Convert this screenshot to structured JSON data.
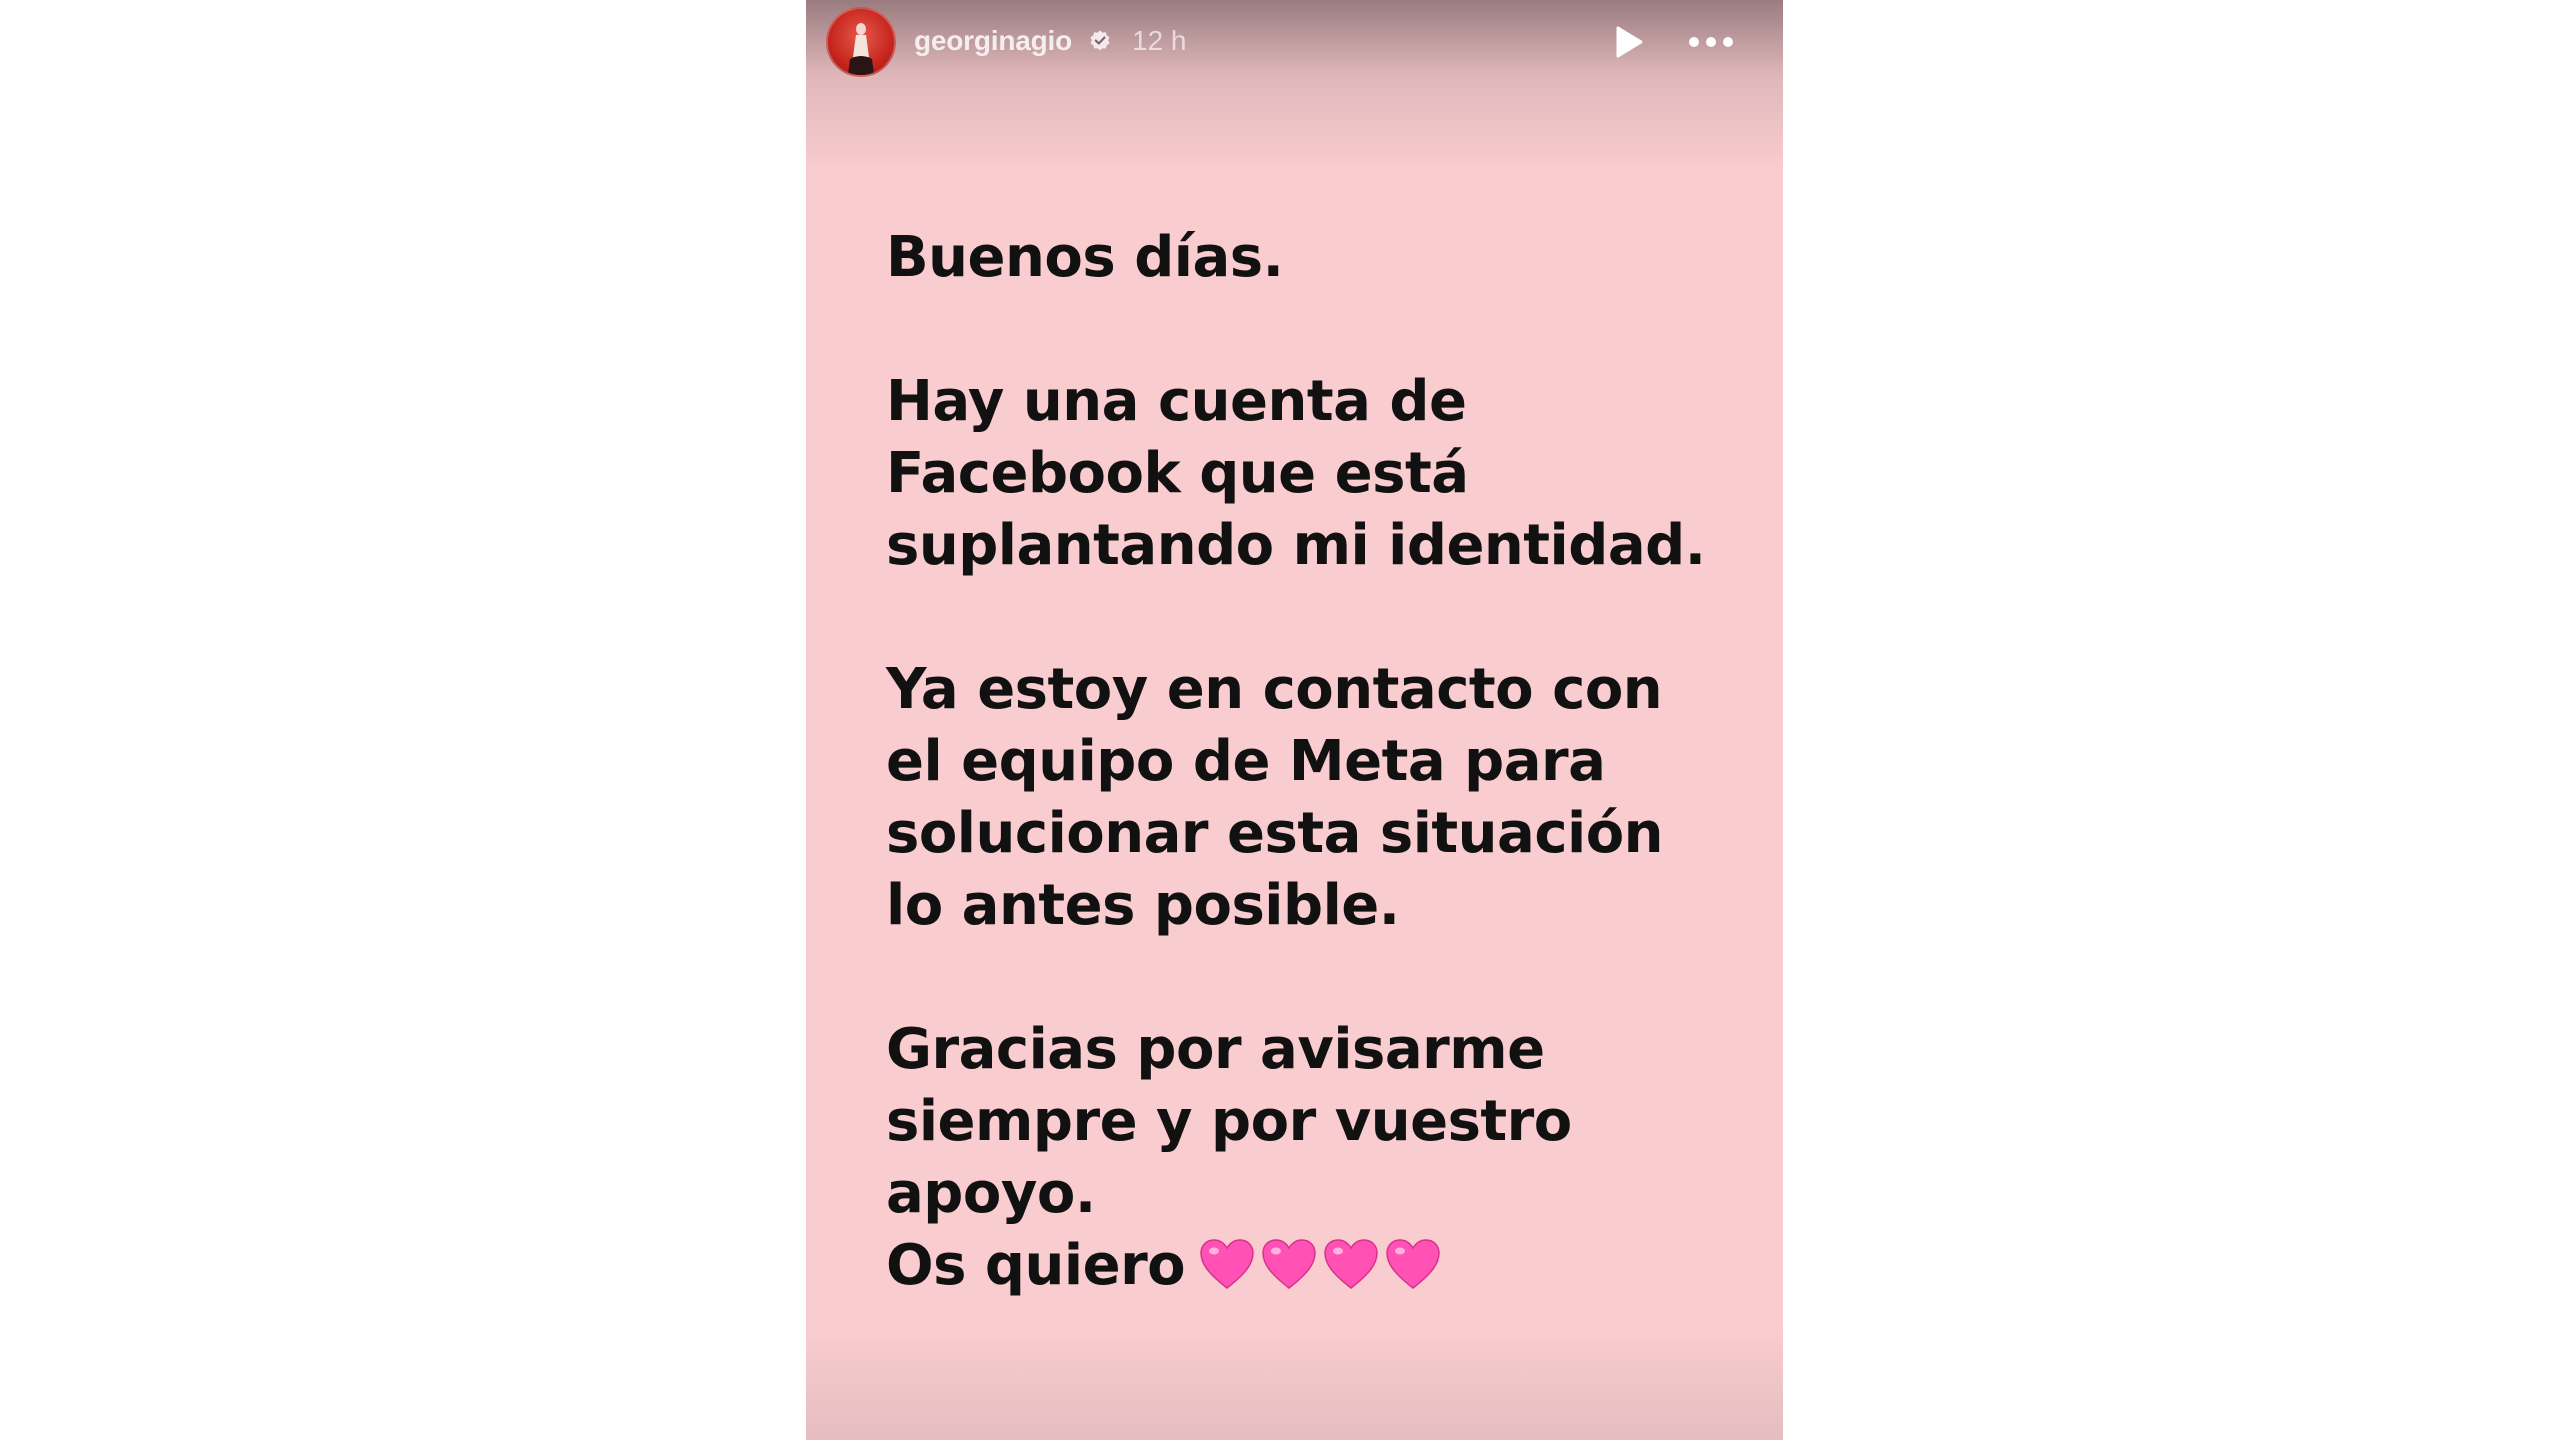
{
  "story": {
    "header": {
      "username": "georginagio",
      "time_ago": "12 h",
      "verified_icon": "verified-badge-icon",
      "play_icon": "play-icon",
      "more_icon": "more-options-icon",
      "avatar_icon": "avatar"
    },
    "message": {
      "greeting": "Buenos días.",
      "paragraph_2": [
        "Hay una cuenta de",
        "Facebook que está",
        "suplantando mi identidad."
      ],
      "paragraph_3": [
        "Ya estoy en contacto con",
        "el equipo de Meta para",
        "solucionar esta situación",
        "lo antes posible."
      ],
      "paragraph_4": [
        "Gracias por avisarme",
        "siempre y por vuestro",
        "apoyo."
      ],
      "closing": "Os quiero",
      "closing_emoji": "pink-heart-icon",
      "closing_emoji_count": 4
    },
    "colors": {
      "background": "#f9cccf",
      "text": "#111111",
      "heart": "#ff52b4"
    }
  }
}
